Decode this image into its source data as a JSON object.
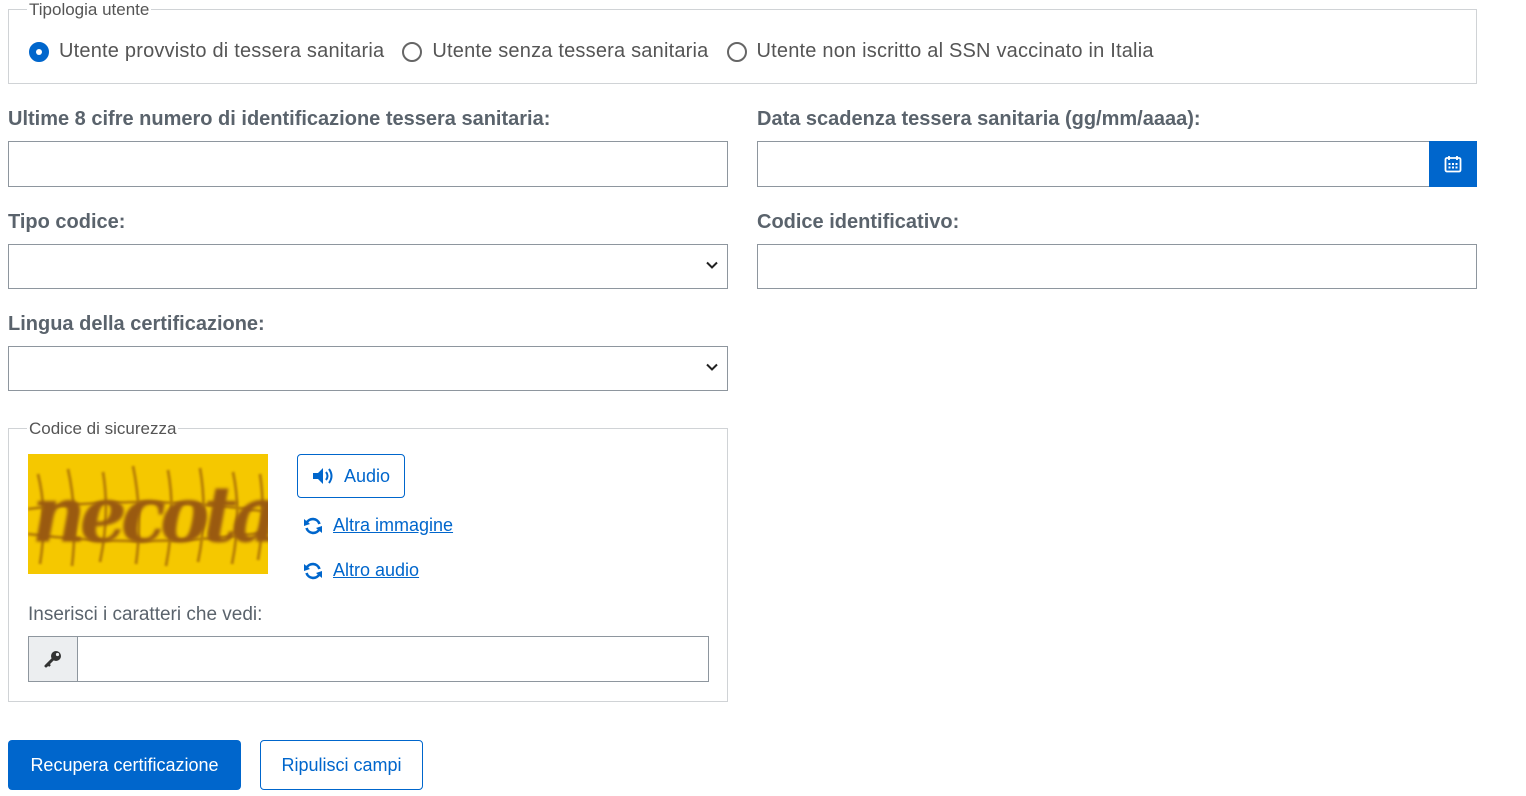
{
  "tipologia": {
    "legend": "Tipologia utente",
    "options": [
      {
        "label": "Utente provvisto di tessera sanitaria",
        "checked": true
      },
      {
        "label": "Utente senza tessera sanitaria",
        "checked": false
      },
      {
        "label": "Utente non iscritto al SSN vaccinato in Italia",
        "checked": false
      }
    ]
  },
  "form": {
    "cifre_label": "Ultime 8 cifre numero di identificazione tessera sanitaria:",
    "cifre_value": "",
    "scadenza_label": "Data scadenza tessera sanitaria (gg/mm/aaaa):",
    "scadenza_value": "",
    "tipo_codice_label": "Tipo codice:",
    "tipo_codice_value": "",
    "codice_id_label": "Codice identificativo:",
    "codice_id_value": "",
    "lingua_label": "Lingua della certificazione:",
    "lingua_value": ""
  },
  "sicurezza": {
    "legend": "Codice di sicurezza",
    "captcha_text": "necotarn",
    "audio_label": "Audio",
    "altra_immagine_label": "Altra immagine",
    "altro_audio_label": "Altro audio",
    "caratteri_label": "Inserisci i caratteri che vedi:",
    "caratteri_value": ""
  },
  "actions": {
    "recupera_label": "Recupera certificazione",
    "ripulisci_label": "Ripulisci campi"
  },
  "colors": {
    "accent": "#0066cc",
    "captcha_bg": "#f5c800"
  }
}
